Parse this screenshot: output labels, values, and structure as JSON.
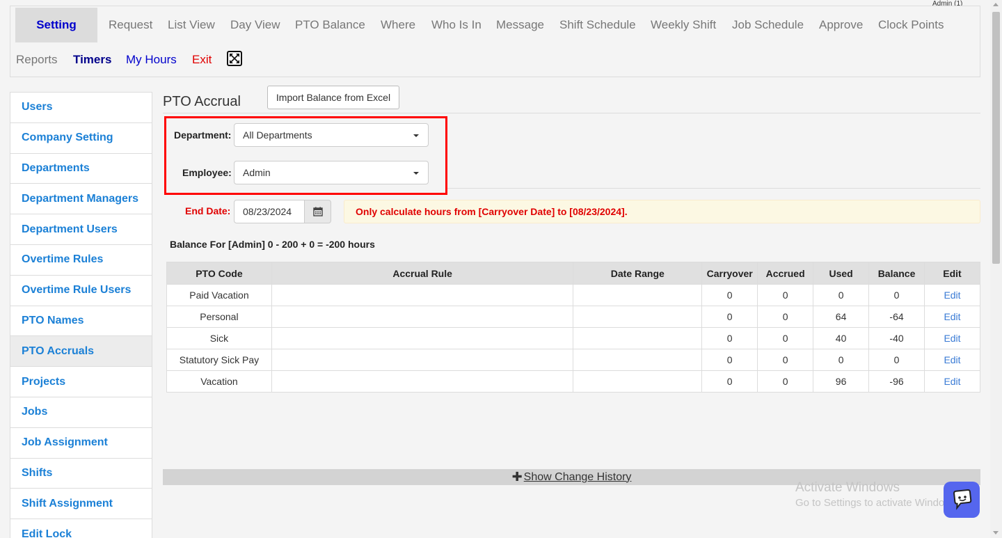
{
  "header": {
    "admin_label": "Admin (1)"
  },
  "nav": {
    "items": [
      "Setting",
      "Request",
      "List View",
      "Day View",
      "PTO Balance",
      "Where",
      "Who Is In",
      "Message",
      "Shift Schedule",
      "Weekly Shift",
      "Job Schedule",
      "Approve",
      "Clock Points",
      "Reports",
      "Timers",
      "My Hours",
      "Exit"
    ]
  },
  "sidebar": {
    "items": [
      "Users",
      "Company Setting",
      "Departments",
      "Department Managers",
      "Department Users",
      "Overtime Rules",
      "Overtime Rule Users",
      "PTO Names",
      "PTO Accruals",
      "Projects",
      "Jobs",
      "Job Assignment",
      "Shifts",
      "Shift Assignment",
      "Edit Lock"
    ],
    "active": "PTO Accruals"
  },
  "main": {
    "title": "PTO Accrual",
    "import_button": "Import Balance from Excel",
    "department_label": "Department:",
    "department_value": "All Departments",
    "employee_label": "Employee:",
    "employee_value": "Admin",
    "end_date_label": "End Date:",
    "end_date_value": "08/23/2024",
    "warning": "Only calculate hours from [Carryover Date] to [08/23/2024].",
    "balance_line": "Balance For [Admin] 0 - 200 + 0 = -200 hours",
    "history_label": " Show Change History"
  },
  "table": {
    "headers": [
      "PTO Code",
      "Accrual Rule",
      "Date Range",
      "Carryover",
      "Accrued",
      "Used",
      "Balance",
      "Edit"
    ],
    "rows": [
      [
        "Paid Vacation",
        "",
        "",
        "0",
        "0",
        "0",
        "0",
        "Edit"
      ],
      [
        "Personal",
        "",
        "",
        "0",
        "0",
        "64",
        "-64",
        "Edit"
      ],
      [
        "Sick",
        "",
        "",
        "0",
        "0",
        "40",
        "-40",
        "Edit"
      ],
      [
        "Statutory Sick Pay",
        "",
        "",
        "0",
        "0",
        "0",
        "0",
        "Edit"
      ],
      [
        "Vacation",
        "",
        "",
        "0",
        "0",
        "96",
        "-96",
        "Edit"
      ]
    ]
  },
  "watermark": {
    "line1": "Activate Windows",
    "line2": "Go to Settings to activate Windows."
  },
  "colors": {
    "link_blue": "#1b80d6",
    "highlight_red": "#ff0000",
    "chat_button": "#5566ee"
  }
}
